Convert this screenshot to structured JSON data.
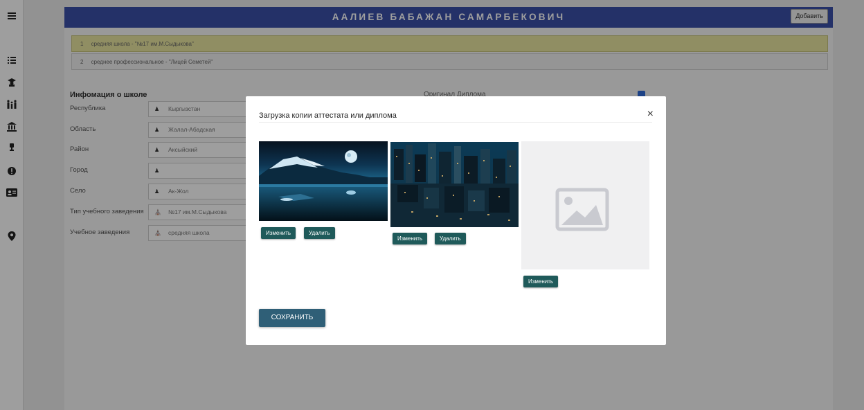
{
  "header": {
    "title": "ААЛИЕВ БАБАЖАН САМАРБЕКОВИЧ",
    "add_label": "Добавить"
  },
  "rail": {
    "icons": [
      "menu-icon",
      "list-icon",
      "graduate-icon",
      "family-icon",
      "institution-icon",
      "trophy-icon",
      "info-icon",
      "id-card-icon",
      "location-pin-icon"
    ]
  },
  "schools": [
    {
      "index": "1",
      "text": "средняя школа - \"№17 им.М.Сыдыкова\""
    },
    {
      "index": "2",
      "text": "среднее профессиональное - \"Лицей Семетей\""
    }
  ],
  "info": {
    "title": "Инфомация о школе",
    "diploma_label": "Оригинал Диплома",
    "diploma_checked": true
  },
  "fields": [
    {
      "label": "Республика",
      "value": "Кыргызстан",
      "icon": "user-icon"
    },
    {
      "label": "Область",
      "value": "Жалал-Абадская",
      "icon": "user-icon"
    },
    {
      "label": "Район",
      "value": "Аксыйский",
      "icon": "user-icon"
    },
    {
      "label": "Город",
      "value": "",
      "icon": "user-icon"
    },
    {
      "label": "Село",
      "value": "Ак-Жол",
      "icon": "user-icon"
    },
    {
      "label": "Тип учебного заведения",
      "value": "№17 им.М.Сыдыкова",
      "icon": "building-icon"
    },
    {
      "label": "Учебное заведения",
      "value": "средняя школа",
      "icon": "building-icon"
    }
  ],
  "modal": {
    "title": "Загрузка копии аттестата или диплома",
    "close": "×",
    "save_label": "СОХРАНИТЬ",
    "change_label": "Изменить",
    "delete_label": "Удалить",
    "images": [
      {
        "name": "night-mountain-lake-image",
        "has_delete": true
      },
      {
        "name": "city-skyline-image",
        "has_delete": true
      },
      {
        "name": "image-placeholder",
        "has_delete": false
      }
    ]
  },
  "colors": {
    "header": "#3b4fa8",
    "selected_row": "#e8e6a0",
    "button_dark": "#1f5a5a",
    "save_button": "#2f5f77"
  }
}
